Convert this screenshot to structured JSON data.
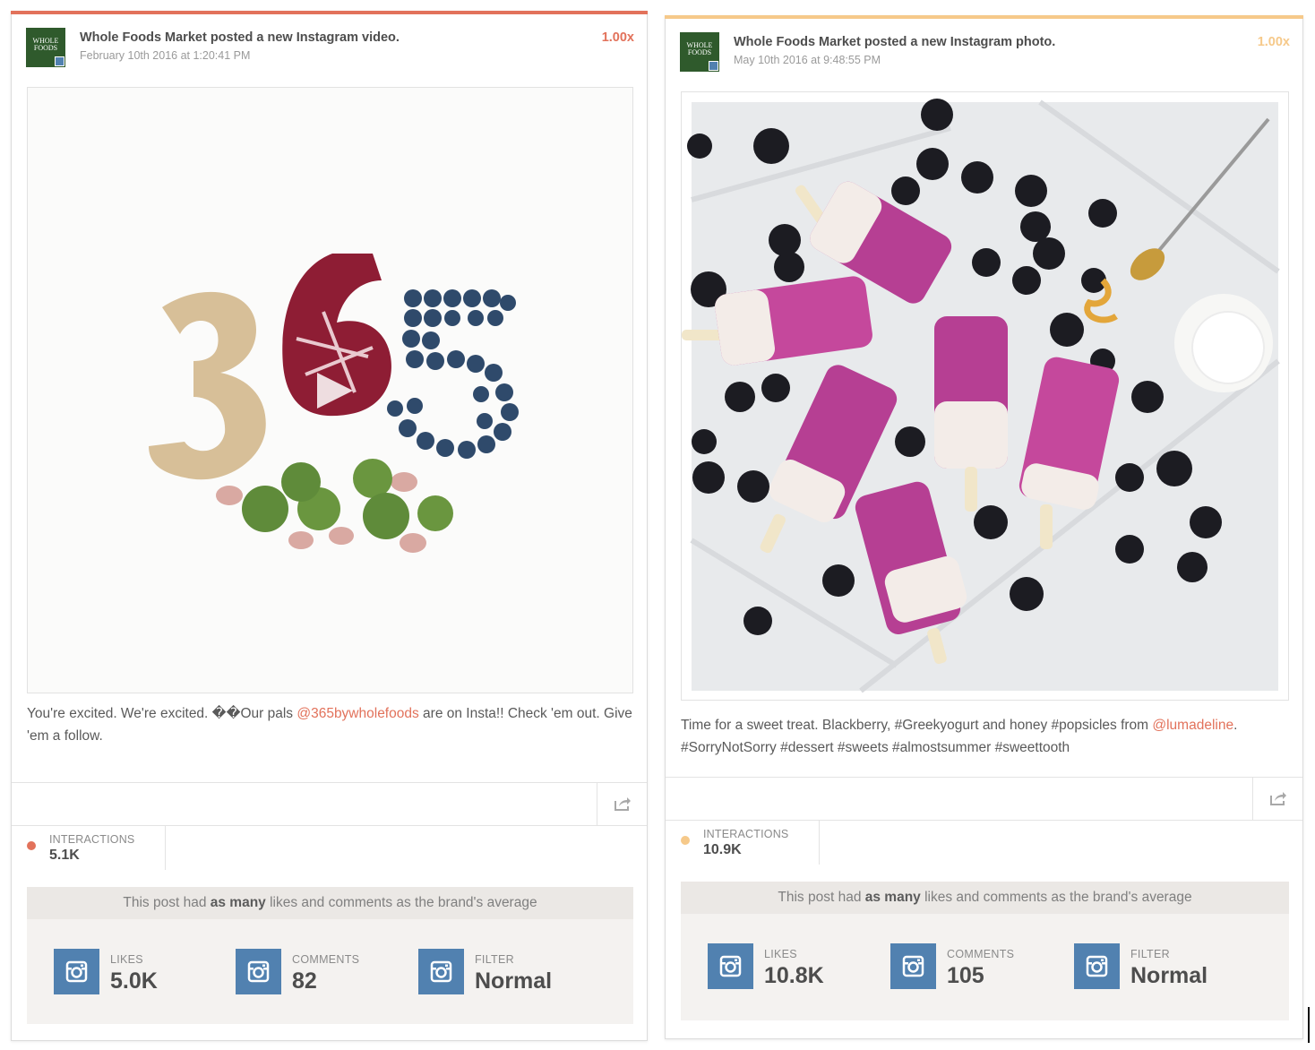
{
  "accent_colors": {
    "post1": "#e2725b",
    "post2": "#f6c98a",
    "mention": "#e2725b",
    "instagram_blue": "#5181b0"
  },
  "posts": [
    {
      "brand_logo_text": "WHOLE FOODS",
      "title": "Whole Foods Market posted a new Instagram video.",
      "timestamp": "February 10th 2016 at 1:20:41 PM",
      "multiplier": "1.00x",
      "media_type": "video",
      "caption_before": "You're excited. We're excited. ��Our pals ",
      "caption_mention": "@365bywholefoods",
      "caption_after": " are on Insta!! Check 'em out. Give 'em a follow.",
      "interactions_label": "INTERACTIONS",
      "interactions_value": "5.1K",
      "notice_before": "This post had ",
      "notice_bold": "as many",
      "notice_after": " likes and comments as the brand's average",
      "stats": [
        {
          "label": "LIKES",
          "value": "5.0K",
          "icon": "instagram-icon"
        },
        {
          "label": "COMMENTS",
          "value": "82",
          "icon": "instagram-icon"
        },
        {
          "label": "FILTER",
          "value": "Normal",
          "icon": "instagram-icon"
        }
      ]
    },
    {
      "brand_logo_text": "WHOLE FOODS",
      "title": "Whole Foods Market posted a new Instagram photo.",
      "timestamp": "May 10th 2016 at 9:48:55 PM",
      "multiplier": "1.00x",
      "media_type": "photo",
      "caption_before": "Time for a sweet treat. Blackberry, #Greekyogurt and honey #popsicles from ",
      "caption_mention": "@lumadeline",
      "caption_after": ". #SorryNotSorry #dessert #sweets #almostsummer #sweettooth",
      "interactions_label": "INTERACTIONS",
      "interactions_value": "10.9K",
      "notice_before": "This post had ",
      "notice_bold": "as many",
      "notice_after": " likes and comments as the brand's average",
      "stats": [
        {
          "label": "LIKES",
          "value": "10.8K",
          "icon": "instagram-icon"
        },
        {
          "label": "COMMENTS",
          "value": "105",
          "icon": "instagram-icon"
        },
        {
          "label": "FILTER",
          "value": "Normal",
          "icon": "instagram-icon"
        }
      ]
    }
  ]
}
